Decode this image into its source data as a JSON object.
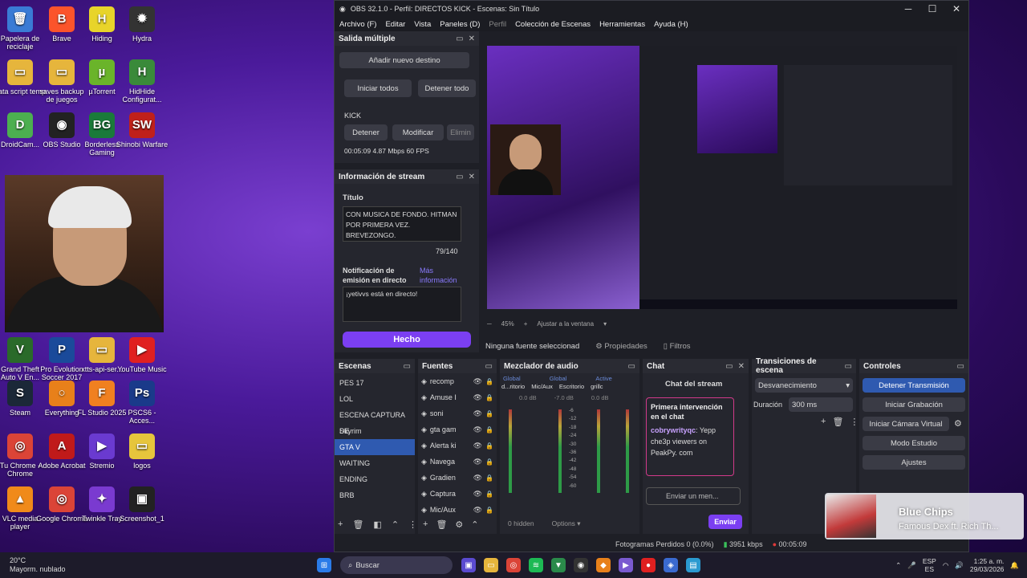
{
  "desktop": {
    "icons": [
      {
        "label": "Papelera de reciclaje",
        "color": "#3a7bd5",
        "g": "🗑"
      },
      {
        "label": "Brave",
        "color": "#fb542b",
        "g": "B"
      },
      {
        "label": "Hiding",
        "color": "#e8d42a",
        "g": "H"
      },
      {
        "label": "Hydra",
        "color": "#333",
        "g": "✹"
      },
      {
        "label": "data script temp",
        "color": "#e6b53c",
        "g": "▭"
      },
      {
        "label": "saves backup de juegos",
        "color": "#e6b53c",
        "g": "▭"
      },
      {
        "label": "µTorrent",
        "color": "#6ab42a",
        "g": "µ"
      },
      {
        "label": "HidHide Configurat...",
        "color": "#3a8a3a",
        "g": "H"
      },
      {
        "label": "DroidCam...",
        "color": "#4caf50",
        "g": "D"
      },
      {
        "label": "OBS Studio",
        "color": "#222",
        "g": "◉"
      },
      {
        "label": "Borderless Gaming",
        "color": "#1a7a3a",
        "g": "BG"
      },
      {
        "label": "Shinobi Warfare",
        "color": "#c0201a",
        "g": "SW"
      },
      {
        "label": "Grand Theft Auto V En...",
        "color": "#2a6a2a",
        "g": "V"
      },
      {
        "label": "Pro Evolution Soccer 2017",
        "color": "#1a4a9a",
        "g": "P"
      },
      {
        "label": "xtts-api-ser...",
        "color": "#e6b53c",
        "g": "▭"
      },
      {
        "label": "YouTube Music",
        "color": "#e02020",
        "g": "▶"
      },
      {
        "label": "Steam",
        "color": "#1b2838",
        "g": "S"
      },
      {
        "label": "Everything",
        "color": "#e8801a",
        "g": "○"
      },
      {
        "label": "FL Studio 2025",
        "color": "#f08020",
        "g": "F"
      },
      {
        "label": "PSCS6 - Acces...",
        "color": "#1a3a8a",
        "g": "Ps"
      },
      {
        "label": "Tu Chrome - Chrome",
        "color": "#db4437",
        "g": "◎"
      },
      {
        "label": "Adobe Acrobat",
        "color": "#c01a1a",
        "g": "A"
      },
      {
        "label": "Stremio",
        "color": "#6a3ad0",
        "g": "▶"
      },
      {
        "label": "logos",
        "color": "#e6c53c",
        "g": "▭"
      },
      {
        "label": "VLC media player",
        "color": "#f08a1a",
        "g": "▲"
      },
      {
        "label": "Google Chrome",
        "color": "#db4437",
        "g": "◎"
      },
      {
        "label": "Twinkle Tray",
        "color": "#7a3ad0",
        "g": "✦"
      },
      {
        "label": "Screenshot_1",
        "color": "#222",
        "g": "▣"
      }
    ]
  },
  "obs": {
    "title": "OBS 32.1.0 - Perfil: DIRECTOS KICK - Escenas: Sin Título",
    "menu": [
      "Archivo (F)",
      "Editar",
      "Vista",
      "Paneles (D)",
      "Perfil",
      "Colección de Escenas",
      "Herramientas",
      "Ayuda (H)"
    ],
    "multi": {
      "title": "Salida múltiple",
      "add": "Añadir nuevo destino",
      "start_all": "Iniciar todos",
      "stop_all": "Detener todo",
      "dest": "KICK",
      "stop": "Detener",
      "modify": "Modificar",
      "delete": "Elimin",
      "stats": "00:05:09  4.87 Mbps  60 FPS"
    },
    "info": {
      "title": "Información de stream",
      "t_label": "Título",
      "t_value": "CON MUSICA DE FONDO. HITMAN POR PRIMERA VEZ. BREVEZONGO.",
      "count": "79/140",
      "notif_label": "Notificación de emisión en directo",
      "more": "Más información",
      "notif_value": "¡yetivvs está en directo!",
      "done": "Hecho"
    },
    "no_source": "Ninguna fuente seleccionad",
    "props": "Propiedades",
    "filters": "Filtros",
    "zoom": "45%",
    "fit": "Ajustar a la ventana",
    "scenes": {
      "title": "Escenas",
      "items": [
        "PES 17",
        "LOL",
        "ESCENA CAPTURA DE",
        "Skyrim",
        "GTA V",
        "WAITING",
        "ENDING",
        "BRB"
      ],
      "selected": 4
    },
    "sources": {
      "title": "Fuentes",
      "items": [
        "recomp",
        "Amuse I",
        "soni",
        "gta gam",
        "Alerta ki",
        "Navega",
        "Gradien",
        "Captura",
        "Mic/Aux"
      ]
    },
    "mixer": {
      "title": "Mezclador de audio",
      "tabs": [
        "Global",
        "Global",
        "Active"
      ],
      "ch": [
        "d...ritorio",
        "Mic/Aux",
        "Escritorio",
        "grillc"
      ],
      "db": [
        "0.0 dB",
        "-7.0 dB",
        "0.0 dB"
      ],
      "hidden": "0 hidden",
      "options": "Options",
      "ticks": [
        "-6",
        "-12",
        "-18",
        "-24",
        "-30",
        "-36",
        "-42",
        "-48",
        "-54",
        "-60"
      ]
    },
    "chat": {
      "title": "Chat",
      "header": "Chat del stream",
      "first": "Primera intervención en el chat",
      "user": "cobrywrityqc",
      "msg": ": Yepp che3p viewers on PeakPy. com",
      "placeholder": "Enviar un men...",
      "send": "Enviar"
    },
    "trans": {
      "title": "Transiciones de escena",
      "value": "Desvanecimiento",
      "dur_label": "Duración",
      "dur": "300 ms"
    },
    "controls": {
      "title": "Controles",
      "items": [
        "Detener Transmisión",
        "Iniciar Grabación",
        "Iniciar Cámara Virtual",
        "Modo Estudio",
        "Ajustes"
      ]
    },
    "status": {
      "dropped": "Fotogramas Perdidos 0 (0.0%)",
      "kbps": "3951 kbps",
      "time": "00:05:09"
    }
  },
  "toast": {
    "title": "Blue Chips",
    "artist": "Famous Dex ft. Rich Th..."
  },
  "taskbar": {
    "temp": "20°C",
    "weather": "Mayorm. nublado",
    "search": "Buscar",
    "lang1": "ESP",
    "lang2": "ES",
    "time": "1:25 a. m.",
    "date": "29/03/2026"
  }
}
